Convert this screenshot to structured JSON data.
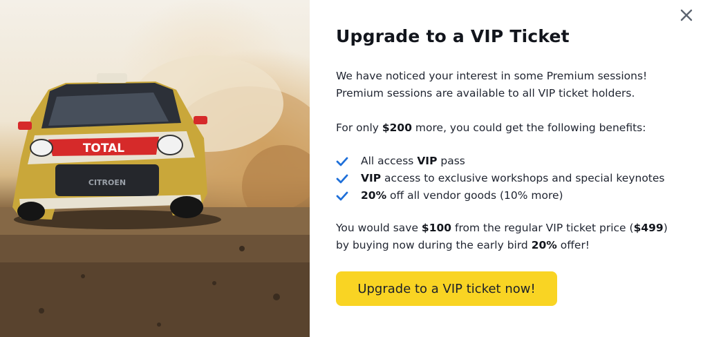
{
  "modal": {
    "title": "Upgrade to a VIP Ticket",
    "close_label": "×",
    "intro": {
      "line1": "We have noticed your interest in some Premium sessions!",
      "line2": "Premium sessions are available to all VIP ticket holders."
    },
    "offer": {
      "prefix": "For only ",
      "price": "$200",
      "suffix": " more, you could get the following benefits:"
    },
    "benefits": [
      {
        "lead": "All access ",
        "bold": "VIP",
        "tail": " pass"
      },
      {
        "lead": "",
        "bold": "VIP",
        "tail": " access to exclusive workshops and special keynotes"
      },
      {
        "lead": "",
        "bold": "20%",
        "tail": " off all vendor goods (10% more)"
      }
    ],
    "savings": {
      "t1": "You would save ",
      "b1": "$100",
      "t2": " from the regular VIP ticket price (",
      "b2": "$499",
      "t3": ")",
      "t4": "by buying now during the early bird ",
      "b3": "20%",
      "t5": " offer!"
    },
    "cta_label": "Upgrade to a VIP ticket now!",
    "hero": {
      "car_text": "TOTAL",
      "grille_text": "CITROEN"
    },
    "colors": {
      "accent": "#f9d423",
      "check": "#1e6fd9",
      "title": "#12151c"
    }
  }
}
